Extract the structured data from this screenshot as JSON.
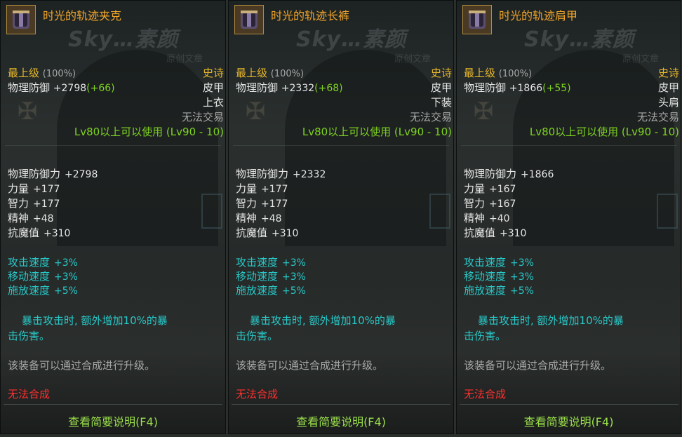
{
  "panels": [
    {
      "name": "时光的轨迹夹克",
      "grade": "最上级",
      "grade_pct": "(100%)",
      "rarity": "史诗",
      "def_label": "物理防御",
      "def_value": "+2798",
      "def_bonus": "(+66)",
      "material": "皮甲",
      "slot": "上衣",
      "trade": "无法交易",
      "level_req": "Lv80以上可以使用 (Lv90 - 10)",
      "stats": [
        {
          "label": "物理防御力",
          "value": "+2798"
        },
        {
          "label": "力量",
          "value": "+177"
        },
        {
          "label": "智力",
          "value": "+177"
        },
        {
          "label": "精神",
          "value": "+48"
        },
        {
          "label": "抗魔值",
          "value": "+310"
        }
      ],
      "speeds": [
        {
          "label": "攻击速度",
          "value": "+3%"
        },
        {
          "label": "移动速度",
          "value": "+3%"
        },
        {
          "label": "施放速度",
          "value": "+5%"
        }
      ],
      "effect_line1": "暴击攻击时, 额外增加10%的暴",
      "effect_line2": "击伤害。",
      "upgrade": "该装备可以通过合成进行升级。",
      "cannot_synth": "无法合成",
      "hint": "查看简要说明(F4)"
    },
    {
      "name": "时光的轨迹长裤",
      "grade": "最上级",
      "grade_pct": "(100%)",
      "rarity": "史诗",
      "def_label": "物理防御",
      "def_value": "+2332",
      "def_bonus": "(+68)",
      "material": "皮甲",
      "slot": "下装",
      "trade": "无法交易",
      "level_req": "Lv80以上可以使用 (Lv90 - 10)",
      "stats": [
        {
          "label": "物理防御力",
          "value": "+2332"
        },
        {
          "label": "力量",
          "value": "+177"
        },
        {
          "label": "智力",
          "value": "+177"
        },
        {
          "label": "精神",
          "value": "+48"
        },
        {
          "label": "抗魔值",
          "value": "+310"
        }
      ],
      "speeds": [
        {
          "label": "攻击速度",
          "value": "+3%"
        },
        {
          "label": "移动速度",
          "value": "+3%"
        },
        {
          "label": "施放速度",
          "value": "+5%"
        }
      ],
      "effect_line1": "暴击攻击时, 额外增加10%的暴",
      "effect_line2": "击伤害。",
      "upgrade": "该装备可以通过合成进行升级。",
      "cannot_synth": "无法合成",
      "hint": "查看简要说明(F4)"
    },
    {
      "name": "时光的轨迹肩甲",
      "grade": "最上级",
      "grade_pct": "(100%)",
      "rarity": "史诗",
      "def_label": "物理防御",
      "def_value": "+1866",
      "def_bonus": "(+55)",
      "material": "皮甲",
      "slot": "头肩",
      "trade": "无法交易",
      "level_req": "Lv80以上可以使用 (Lv90 - 10)",
      "stats": [
        {
          "label": "物理防御力",
          "value": "+1866"
        },
        {
          "label": "力量",
          "value": "+167"
        },
        {
          "label": "智力",
          "value": "+167"
        },
        {
          "label": "精神",
          "value": "+40"
        },
        {
          "label": "抗魔值",
          "value": "+310"
        }
      ],
      "speeds": [
        {
          "label": "攻击速度",
          "value": "+3%"
        },
        {
          "label": "移动速度",
          "value": "+3%"
        },
        {
          "label": "施放速度",
          "value": "+5%"
        }
      ],
      "effect_line1": "暴击攻击时, 额外增加10%的暴",
      "effect_line2": "击伤害。",
      "upgrade": "该装备可以通过合成进行升级。",
      "cannot_synth": "无法合成",
      "hint": "查看简要说明(F4)"
    }
  ],
  "watermark": {
    "brand": "Sky…素颜",
    "sub": "原创文章"
  },
  "colors": {
    "item_name": "#f2a62a",
    "grade": "#e8b82a",
    "level_req": "#7ed321",
    "speed": "#28c9c9",
    "cannot_synth": "#ff3030",
    "hint": "#9be04a"
  }
}
